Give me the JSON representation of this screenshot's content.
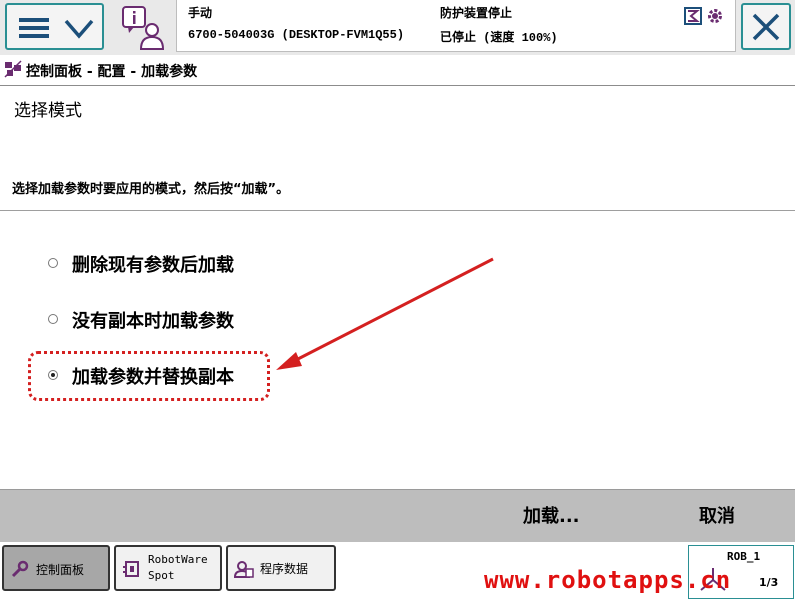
{
  "status": {
    "mode": "手动",
    "controller": "6700-504003G (DESKTOP-FVM1Q55)",
    "safety": "防护装置停止",
    "run_state": "已停止 (速度 100%)"
  },
  "breadcrumb": "控制面板 - 配置 - 加载参数",
  "section_title": "选择模式",
  "instruction": "选择加载参数时要应用的模式，然后按“加载”。",
  "options": [
    {
      "label": "删除现有参数后加载",
      "selected": false
    },
    {
      "label": "没有副本时加载参数",
      "selected": false
    },
    {
      "label": "加载参数并替换副本",
      "selected": true
    }
  ],
  "actions": {
    "load": "加载...",
    "cancel": "取消"
  },
  "taskbar": {
    "control_panel": "控制面板",
    "robotware_line1": "RobotWare",
    "robotware_line2": "Spot",
    "program_data": "程序数据"
  },
  "quickset": {
    "unit": "ROB_1",
    "speed": "1/3"
  },
  "watermark": "www.robotapps.cn",
  "colors": {
    "accent": "#2a8f93",
    "highlight": "#d42020",
    "action_bar": "#bdbdbd"
  }
}
